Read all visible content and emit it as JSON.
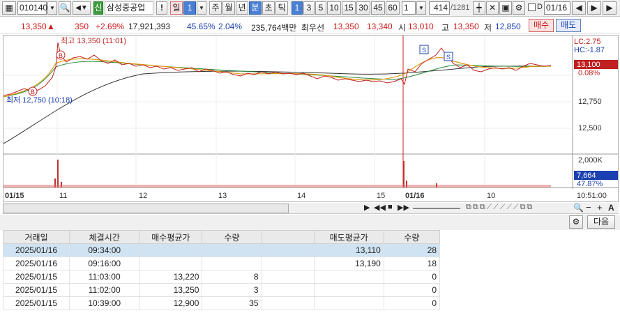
{
  "toolbar": {
    "code": "010140",
    "search_icon": "search-icon",
    "credit_badge": "신",
    "stock_name": "삼성중공업",
    "warn": "!",
    "period_sel": "일",
    "period_num": "1",
    "periods": [
      "주",
      "월",
      "년",
      "분",
      "초",
      "틱"
    ],
    "intervals": [
      "1",
      "3",
      "5",
      "10",
      "15",
      "30",
      "45",
      "60"
    ],
    "interval_value": "1",
    "count": "414",
    "total": "/1281",
    "date": "01/16",
    "checkbox_label": "D"
  },
  "info": {
    "price": "13,350",
    "arrow": "▲",
    "change": "350",
    "rate": "+2.69%",
    "volume": "17,921,393",
    "ratio1": "45.65%",
    "ratio2": "2.04%",
    "amount": "235,764백만",
    "pref_label": "최우선",
    "ask": "13,350",
    "bid": "13,340",
    "open_label": "시",
    "open": "13,010",
    "high_label": "고",
    "high": "13,350",
    "low_label": "저",
    "low": "12,850",
    "buy": "매수",
    "sell": "매도"
  },
  "chart": {
    "max_label": "최고 13,350 (11:01)",
    "min_label": "최저 12,750 (10:18)",
    "lc": "LC:2.75",
    "hc": "HC:-1.87",
    "price_tag": "13,100",
    "pct_tag": "0.08%",
    "y_ticks": [
      "12,750",
      "12,500"
    ],
    "vol_tick": "2,000K",
    "vol_tag": "7,664",
    "vol_pct": "47.87%",
    "time_tag": "10:51:00",
    "x_labels": [
      "01/15",
      "11",
      "12",
      "13",
      "14",
      "15",
      "01/16",
      "10"
    ],
    "marks": {
      "b": "B",
      "s": "S"
    }
  },
  "panel": {
    "next_button": "다음"
  },
  "table": {
    "headers": [
      "거래일",
      "체결시간",
      "매수평균가",
      "수량",
      "",
      "매도평균가",
      "수량"
    ],
    "rows": [
      [
        "2025/01/16",
        "09:34:00",
        "",
        "",
        "",
        "13,110",
        "28"
      ],
      [
        "2025/01/16",
        "09:16:00",
        "",
        "",
        "",
        "13,190",
        "18"
      ],
      [
        "2025/01/15",
        "11:03:00",
        "13,220",
        "8",
        "",
        "",
        "0"
      ],
      [
        "2025/01/15",
        "11:02:00",
        "13,250",
        "3",
        "",
        "",
        "0"
      ],
      [
        "2025/01/15",
        "10:39:00",
        "12,900",
        "35",
        "",
        "",
        "0"
      ]
    ]
  },
  "colors": {
    "up": "#d01919",
    "down": "#1a3fb0",
    "accent": "#4a7fd4"
  }
}
